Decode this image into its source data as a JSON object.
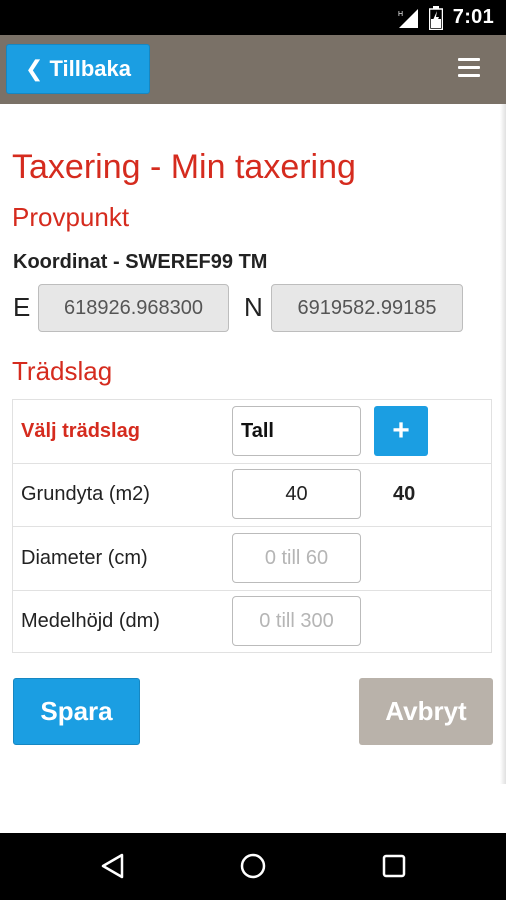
{
  "status_bar": {
    "time": "7:01",
    "icons": [
      "signal-icon",
      "battery-icon"
    ]
  },
  "header": {
    "back_label": "Tillbaka",
    "back_icon": "chevron-left-icon",
    "menu_icon": "hamburger-menu-icon",
    "colors": {
      "background": "#7a7167",
      "button": "#1b9ee2"
    }
  },
  "page": {
    "title": "Taxering - Min taxering",
    "provpunkt_heading": "Provpunkt",
    "coordinate_label": "Koordinat - SWEREF99 TM",
    "easting_letter": "E",
    "easting_value": "618926.968300",
    "northing_letter": "N",
    "northing_value": "6919582.99185",
    "tradslag_heading": "Trädslag",
    "accent_color": "#d52b1e"
  },
  "tree_table": {
    "species": {
      "label": "Välj trädslag",
      "value": "Tall",
      "add_icon": "plus-icon"
    },
    "rows": [
      {
        "label": "Grundyta (m2)",
        "value": "40",
        "computed": "40"
      },
      {
        "label": "Diameter (cm)",
        "placeholder": "0 till 60"
      },
      {
        "label": "Medelhöjd (dm)",
        "placeholder": "0 till 300"
      }
    ]
  },
  "actions": {
    "save_label": "Spara",
    "cancel_label": "Avbryt"
  },
  "nav_bar": {
    "icons": [
      "back-triangle-icon",
      "home-circle-icon",
      "recents-square-icon"
    ]
  }
}
